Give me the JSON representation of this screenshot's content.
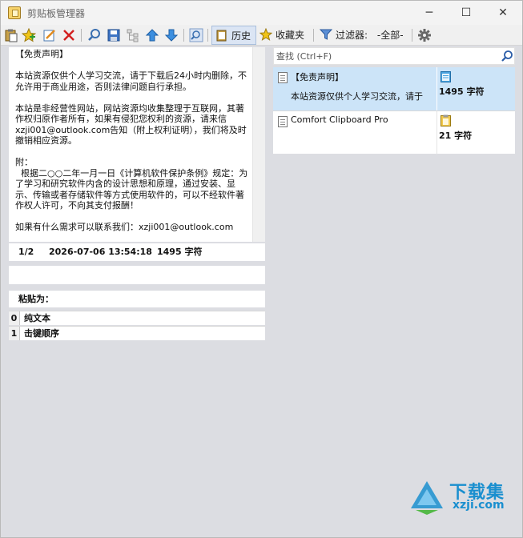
{
  "window": {
    "title": "剪贴板管理器",
    "minimize": "─",
    "maximize": "☐",
    "close": "✕"
  },
  "toolbar": {
    "history_label": "历史",
    "favorites_label": "收藏夹",
    "filter_label": "过滤器:",
    "filter_value": "-全部-"
  },
  "preview": {
    "text": "【免责声明】\n\n本站资源仅供个人学习交流，请于下载后24小时内删除，不允许用于商业用途，否则法律问题自行承担。\n\n本站是非经营性网站，网站资源均收集整理于互联网，其著作权归原作者所有，如果有侵犯您权利的资源，请来信xzji001@outlook.com告知（附上权利证明），我们将及时撤销相应资源。\n\n附：\n  根据二○○二年一月一日《计算机软件保护条例》规定：为了学习和研究软件内含的设计思想和原理，通过安装、显示、传输或者存储软件等方式使用软件的，可以不经软件著作权人许可，不向其支付报酬！\n\n如果有什么需求可以联系我们：xzji001@outlook.com"
  },
  "status": {
    "position": "1/2",
    "datetime": "2026-07-06 13:54:18",
    "chars": "1495 字符"
  },
  "paste_as": {
    "header": "粘贴为：",
    "items": [
      {
        "num": "0",
        "label": "纯文本"
      },
      {
        "num": "1",
        "label": "击键顺序"
      }
    ]
  },
  "search": {
    "placeholder": "查找 (Ctrl+F)"
  },
  "clips": [
    {
      "title": "【免责声明】",
      "preview": "本站资源仅供个人学习交流，请于",
      "count": "1495 字符",
      "selected": true
    },
    {
      "title": "Comfort Clipboard Pro",
      "preview": "",
      "count": "21 字符",
      "selected": false
    }
  ],
  "watermark": {
    "title": "下载集",
    "url": "xzji.com"
  },
  "colors": {
    "selection": "#cce4f8",
    "accent": "#1a8fcf",
    "window_bg": "#dcdde2"
  }
}
